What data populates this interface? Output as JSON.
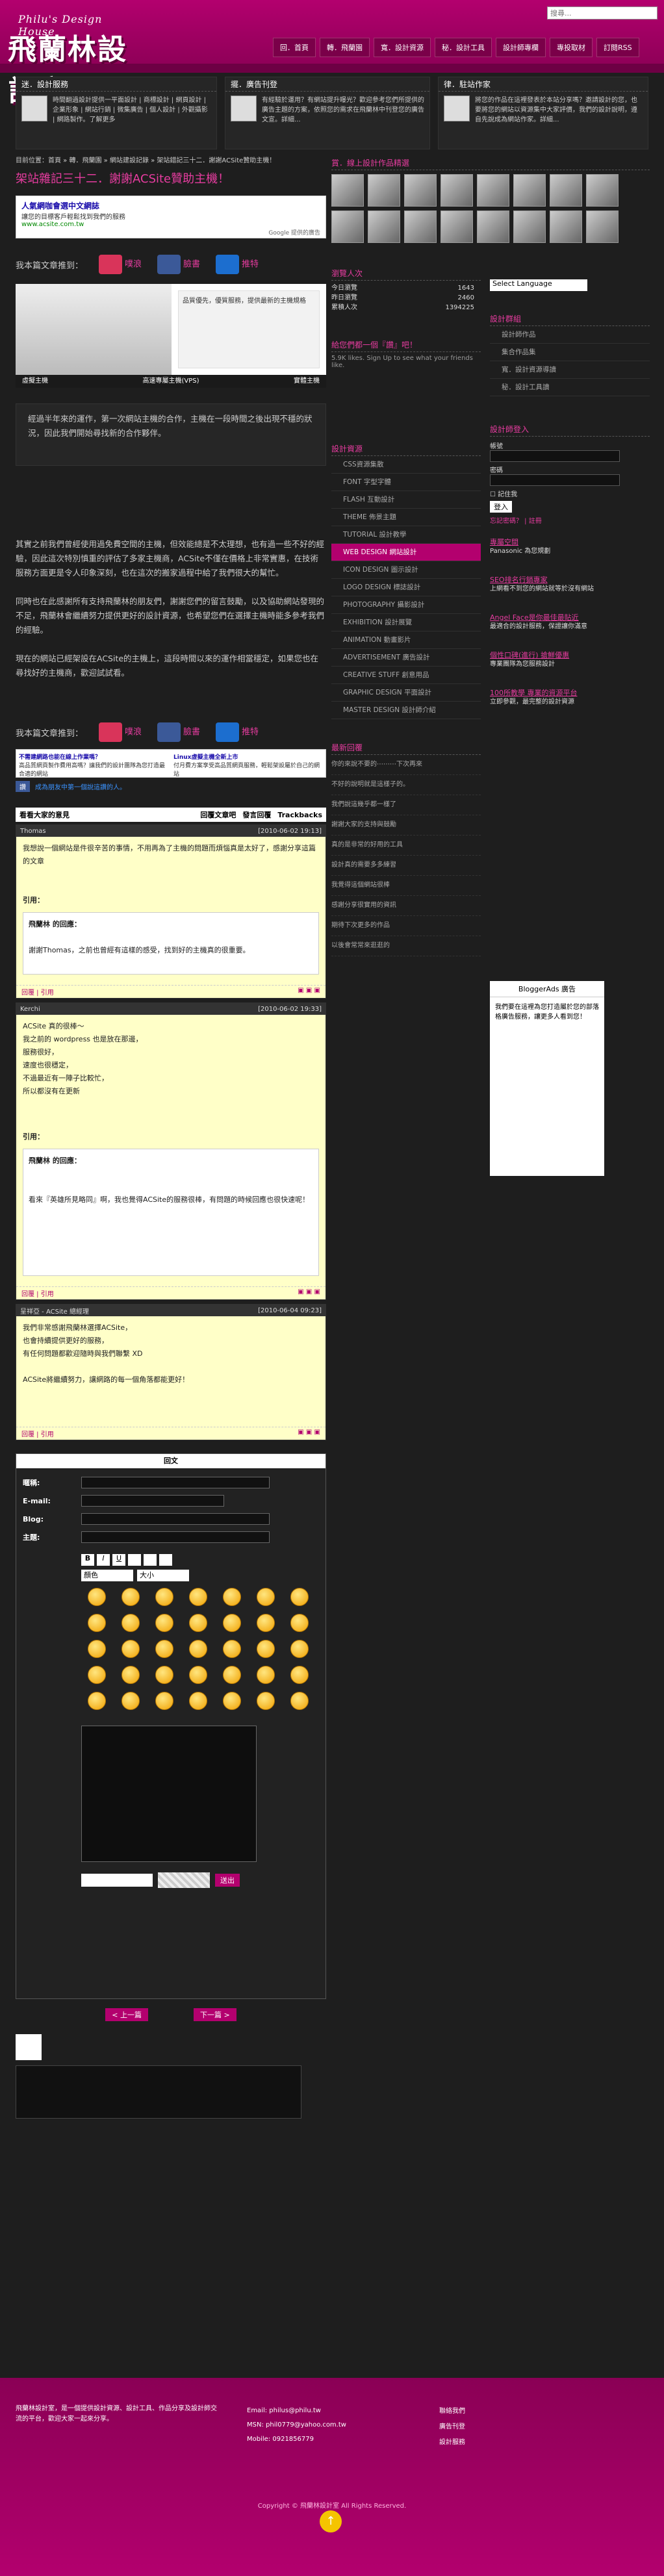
{
  "site": {
    "logo_sub": "Philu's Design House",
    "logo_main": "飛蘭林設計室"
  },
  "search": {
    "placeholder": "搜尋..."
  },
  "nav": [
    "回．首頁",
    "轉．飛蘭園",
    "寬．設計資源",
    "秘．設計工具",
    "設計師專欄",
    "專投取材",
    "訂閱RSS"
  ],
  "topboxes": [
    {
      "title": "迷．設計服務",
      "text": "時間翻過設計提供一平面設計 | 商標設計 | 網頁設計 | 企業形象 | 網站行銷 | 微集廣告 | 個人設計 | 外觀攝影 | 網路製作。了解更多"
    },
    {
      "title": "擺．廣告刊登",
      "text": "有經驗於運用？有網站提升曝光？歡迎參考您們所提供的廣告主題的方案，依照您的需求在飛蘭林中刊登您的廣告文宣。詳細..."
    },
    {
      "title": "律．駐站作家",
      "text": "將您的作品在這裡發表於本站分享嗎？邀請設計的您，也要將您的網站以資源集中大家評價，我們的設計說明，遵自先說成為網站作家。詳細..."
    }
  ],
  "crumb": "目前位置：首頁 » 轉．飛蘭園 » 網站建設記錄 » 架站錯記三十二．謝謝ACSite贊助主機！",
  "post": {
    "title": "架站雜記三十二．謝謝ACSite贊助主機！"
  },
  "ad_top": {
    "headline": "人氣網咖會選中文網誌",
    "body": "讓您的目標客戶輕鬆找到我們的服務",
    "url": "www.acsite.com.tw",
    "badge": "Google 提供的廣告"
  },
  "share": {
    "label": "我本篇文章推到：",
    "plurk": "噗浪",
    "facebook": "臉書",
    "digg": "推特"
  },
  "banner": {
    "caption_left": "虛擬主機",
    "caption_mid": "高速專屬主機(VPS)",
    "caption_right": "實體主機",
    "tagline": "品質優先，優質服務，提供最新的主機規格"
  },
  "paragraphs": [
    "經過半年來的運作，第一次網站主機的合作，主機在一段時間之後出現不穩的狀況，因此我們開始尋找新的合作夥伴。",
    "其實之前我們曾經使用過免費空間的主機，但效能總是不太理想，也有過一些不好的經驗，因此這次特別慎重的評估了多家主機商，ACSite不僅在價格上非常實惠，在技術服務方面更是令人印象深刻，也在這次的搬家過程中給了我們很大的幫忙。",
    "同時也在此感謝所有支持飛蘭林的朋友們，謝謝您們的留言鼓勵，以及協助網站發現的不足，飛蘭林會繼續努力提供更好的設計資源，也希望您們在選擇主機時能多參考我們的經驗。",
    "現在的網站已經架設在ACSite的主機上，這段時間以來的運作相當穩定，如果您也在尋找好的主機商，歡迎試試看。"
  ],
  "ads_bottom": [
    {
      "title": "不需建網路也能在線上作業嗎？",
      "body": "高品質網頁製作費用高嗎？讓我們的設計團隊為您打造最合適的網站"
    },
    {
      "title": "Linux虛擬主機全新上市",
      "body": "付月費方案享受高品質網頁服務，輕鬆架設屬於自己的網站"
    }
  ],
  "fb_like": {
    "label": "讚",
    "text": "成為朋友中第一個說這讚的人。"
  },
  "comments_head": {
    "title": "看看大家的意見",
    "tab1": "回覆文章吧",
    "tab2": "發言回覆",
    "tab3": "Trackbacks"
  },
  "comments": [
    {
      "author": "Thomas",
      "date": "[2010-06-02 19:13]",
      "body": "我想說一個網站是件很辛苦的事情，不用再為了主機的問題而煩惱真是太好了，感謝分享這篇的文章",
      "reply_label": "引用：",
      "reply_head": "飛蘭林 的回應：",
      "reply_body": "謝謝Thomas，之前也曾經有這樣的感受，找到好的主機真的很重要。",
      "foot": "回覆 | 引用"
    },
    {
      "author": "Kerchi",
      "date": "[2010-06-02 19:33]",
      "body": "ACSite 真的很棒～\n我之前的 wordpress 也是放在那邊，\n服務很好，\n速度也很穩定，\n不過最近有一陣子比較忙，\n所以都沒有在更新",
      "reply_label": "引用：",
      "reply_head": "飛蘭林 的回應：",
      "reply_body": "看來『英雄所見略同』啊，我也覺得ACSite的服務很棒，有問題的時候回應也很快速呢！",
      "foot": "回覆 | 引用"
    },
    {
      "author": "呈祥亞 - ACSite 總經理",
      "date": "[2010-06-04 09:23]",
      "body": "我們非常感謝飛蘭林選擇ACSite，\n也會持續提供更好的服務，\n有任何問題都歡迎隨時與我們聯繫 XD\n\nACSite將繼續努力，讓網路的每一個角落都能更好！",
      "foot": "回覆 | 引用"
    }
  ],
  "form": {
    "title": "回文",
    "name": "暱稱:",
    "email": "E-mail:",
    "blog": "Blog:",
    "subject": "主題:",
    "color": "顏色",
    "size": "大小",
    "submit": "送出",
    "prev": "< 上一篇",
    "next": "下一篇 >"
  },
  "right": {
    "gallery_title": "賞．線上設計作品精選",
    "stats_title": "瀏覽人次",
    "stats": [
      {
        "k": "今日瀏覽",
        "v": "1643"
      },
      {
        "k": "昨日瀏覽",
        "v": "2460"
      },
      {
        "k": "累積人次",
        "v": "1394225"
      }
    ],
    "lang": "Select Language",
    "fb_title": "給您們都一個『讚』吧！",
    "fb_text": "5.9K likes. Sign Up to see what your friends like.",
    "cat_title": "設計群組",
    "cats": [
      "設計師作品",
      "集合作品集",
      "寬．設計資源導讀",
      "秘．設計工具讀"
    ],
    "res_title": "設計資源",
    "res": [
      "CSS資源集散",
      "FONT 字型字體",
      "FLASH 互動設計",
      "THEME 佈景主題",
      "TUTORIAL 設計教學",
      "WEB DESIGN 網站設計",
      "ICON DESIGN 圖示設計",
      "LOGO DESIGN 標誌設計",
      "PHOTOGRAPHY 攝影設計",
      "EXHIBITION 設計展覽",
      "ANIMATION 動畫影片",
      "ADVERTISEMENT 廣告設計",
      "CREATIVE STUFF 創意用品",
      "GRAPHIC DESIGN 平面設計",
      "MASTER DESIGN 設計師介紹"
    ],
    "login_title": "設計師登入",
    "login_account": "帳號",
    "login_pw": "密碼",
    "login_remember": "記住我",
    "login_btn": "登入",
    "login_links": "忘記密碼？ | 註冊",
    "google_ads": [
      {
        "t": "專屬空間",
        "b": "Panasonic 為您規劃"
      },
      {
        "t": "SEO排名行銷專家",
        "b": "上網看不到您的網站就等於沒有網站"
      },
      {
        "t": "Angel Face是你最佳最貼近",
        "b": "最適合的設計服務，保證讓你滿意"
      },
      {
        "t": "個性口碑(進行) 搶鮮優惠",
        "b": "專業團隊為您服務設計"
      },
      {
        "t": "100所教學 專業的資源平台",
        "b": "立即參觀，最完整的設計資源"
      }
    ],
    "recent_title": "最新回覆",
    "recent": [
      "你的來說不要的⋯⋯⋯下次再來",
      "不好的說明就是這樣子的。",
      "我們說這幾乎都一樣了",
      "謝謝大家的支持與鼓勵",
      "真的是非常的好用的工具",
      "設計真的需要多多練習",
      "我覺得這個網站很棒",
      "感謝分享很實用的資訊",
      "期待下次更多的作品",
      "以後會常常來逛逛的"
    ],
    "bloggerads": {
      "title": "BloggerAds 廣告",
      "body": "我們要在這裡為您打造屬於您的部落格廣告服務，讓更多人看到您！"
    }
  },
  "footer": {
    "about": "飛蘭林設計室，是一個提供設計資源、設計工具、作品分享及設計師交流的平台，歡迎大家一起來分享。",
    "contact": [
      "Email: philus@philu.tw",
      "MSN: phil0779@yahoo.com.tw",
      "Mobile: 0921856779"
    ],
    "links": [
      "聯絡我們",
      "廣告刊登",
      "設計服務"
    ],
    "copy": "Copyright © 飛蘭林設計室 All Rights Reserved."
  }
}
